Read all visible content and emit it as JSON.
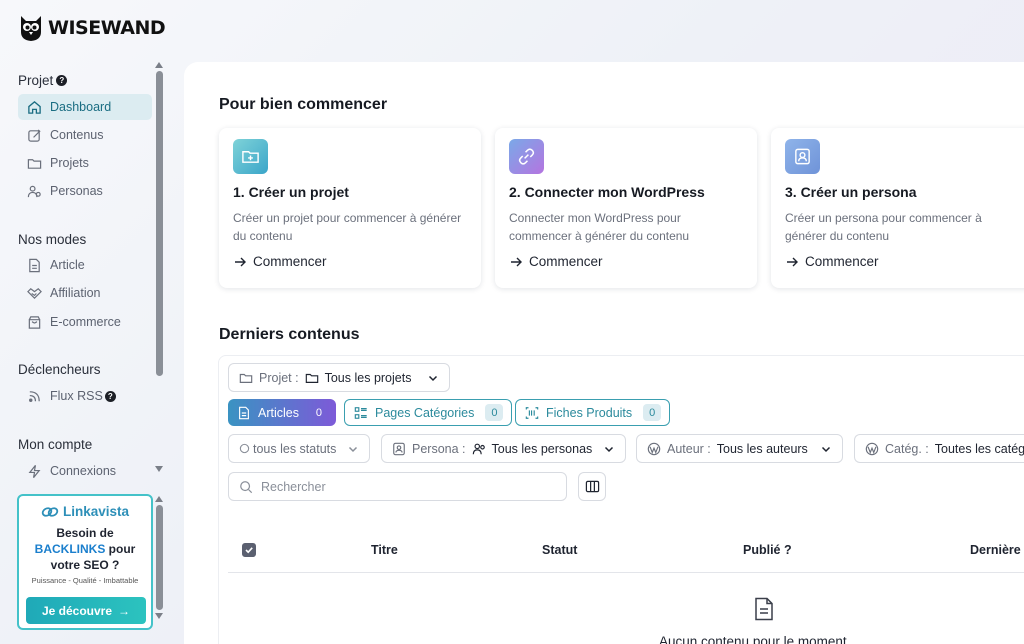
{
  "brand": {
    "name": "WISEWAND"
  },
  "sidebar": {
    "sections": [
      {
        "title": "Projet",
        "help": "?"
      },
      {
        "title": "Nos modes"
      },
      {
        "title": "Déclencheurs"
      },
      {
        "title": "Mon compte"
      }
    ],
    "items": [
      {
        "label": "Dashboard",
        "icon": "home-icon",
        "active": true
      },
      {
        "label": "Contenus",
        "icon": "edit-icon"
      },
      {
        "label": "Projets",
        "icon": "folder-icon"
      },
      {
        "label": "Personas",
        "icon": "users-icon"
      },
      {
        "label": "Article",
        "icon": "document-icon"
      },
      {
        "label": "Affiliation",
        "icon": "handshake-icon"
      },
      {
        "label": "E-commerce",
        "icon": "shopping-bag-icon"
      },
      {
        "label": "Flux RSS",
        "icon": "rss-icon",
        "help": "?"
      },
      {
        "label": "Connexions",
        "icon": "lightning-icon"
      }
    ]
  },
  "promo": {
    "brand": "Linkavista",
    "line1": "Besoin de",
    "highlight": "BACKLINKS",
    "line2_suffix": " pour",
    "line3": "votre SEO ?",
    "tagline": "Puissance - Qualité - Imbattable",
    "button": "Je découvre",
    "button_arrow": "→"
  },
  "getting_started": {
    "title": "Pour bien commencer",
    "cards": [
      {
        "title": "1. Créer un projet",
        "desc": "Créer un projet pour commencer à générer du contenu",
        "cta": "Commencer",
        "icon": "folder-plus-icon"
      },
      {
        "title": "2. Connecter mon WordPress",
        "desc": "Connecter mon WordPress pour commencer à générer du contenu",
        "cta": "Commencer",
        "icon": "link-icon"
      },
      {
        "title": "3. Créer un persona",
        "desc": "Créer un persona pour commencer à générer du contenu",
        "cta": "Commencer",
        "icon": "user-card-icon"
      }
    ]
  },
  "latest": {
    "title": "Derniers contenus",
    "project_filter": {
      "label": "Projet :",
      "value": "Tous les projets"
    },
    "tabs": [
      {
        "label": "Articles",
        "count": "0",
        "active": true
      },
      {
        "label": "Pages Catégories",
        "count": "0"
      },
      {
        "label": "Fiches Produits",
        "count": "0"
      }
    ],
    "filters": {
      "status": "tous les statuts",
      "persona": {
        "label": "Persona :",
        "value": "Tous les personas"
      },
      "author": {
        "label": "Auteur :",
        "value": "Tous les auteurs"
      },
      "category": {
        "label": "Catég. :",
        "value": "Toutes les catég"
      }
    },
    "search_placeholder": "Rechercher",
    "columns": [
      "Titre",
      "Statut",
      "Publié ?",
      "Dernière"
    ],
    "empty": "Aucun contenu pour le moment"
  },
  "colors": {
    "accent": "#1a6d82",
    "active_bg": "#dcecf1",
    "teal": "#3a9fb0",
    "gradient_start": "#3a93c2",
    "gradient_end": "#7d5ad8"
  }
}
